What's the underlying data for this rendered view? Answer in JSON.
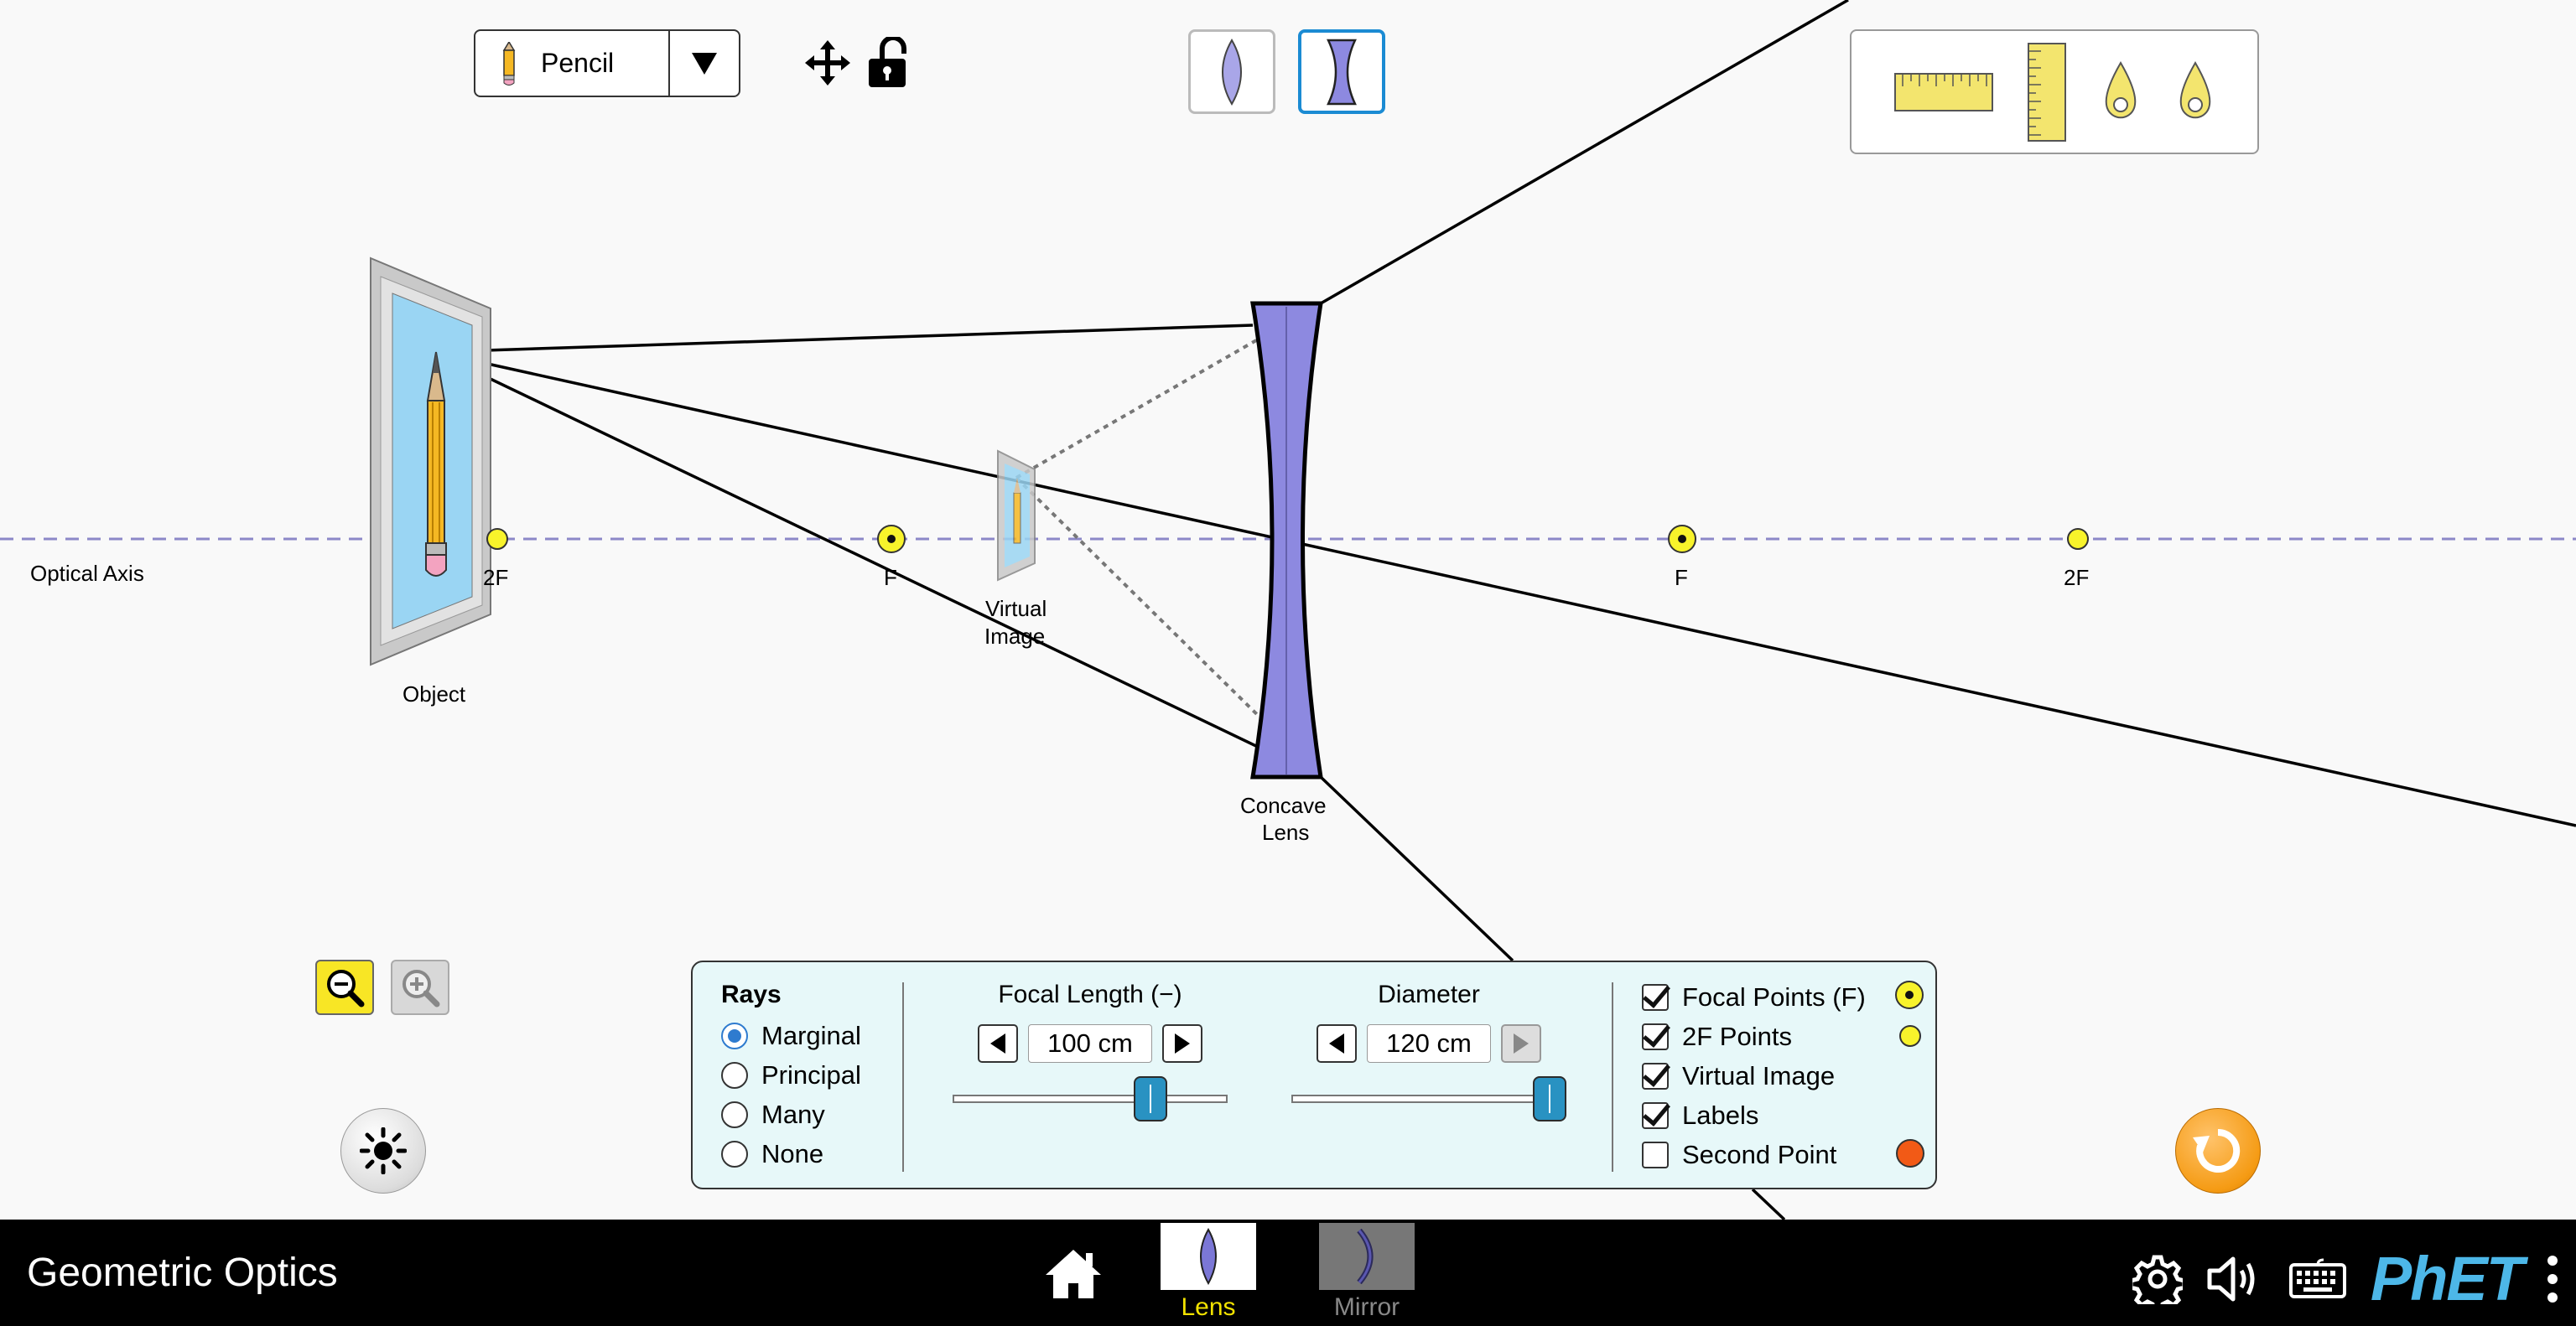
{
  "object_selector": {
    "label": "Pencil"
  },
  "scene": {
    "axis_label": "Optical Axis",
    "object_label": "Object",
    "image_label_line1": "Virtual",
    "image_label_line2": "Image",
    "lens_label_line1": "Concave",
    "lens_label_line2": "Lens",
    "left_2f_label": "2F",
    "left_f_label": "F",
    "right_f_label": "F",
    "right_2f_label": "2F"
  },
  "panel": {
    "rays_title": "Rays",
    "rays": [
      {
        "label": "Marginal",
        "selected": true
      },
      {
        "label": "Principal",
        "selected": false
      },
      {
        "label": "Many",
        "selected": false
      },
      {
        "label": "None",
        "selected": false
      }
    ],
    "focal_length": {
      "title": "Focal Length (−)",
      "value": "100 cm",
      "slider_fraction": 0.75
    },
    "diameter": {
      "title": "Diameter",
      "value": "120 cm",
      "slider_fraction": 1.0
    },
    "checks": [
      {
        "label": "Focal Points (F)",
        "checked": true
      },
      {
        "label": "2F Points",
        "checked": true
      },
      {
        "label": "Virtual Image",
        "checked": true
      },
      {
        "label": "Labels",
        "checked": true
      },
      {
        "label": "Second Point",
        "checked": false
      }
    ]
  },
  "navbar": {
    "title": "Geometric Optics",
    "screens": [
      {
        "label": "Lens",
        "selected": true
      },
      {
        "label": "Mirror",
        "selected": false
      }
    ],
    "brand": "PhET"
  },
  "colors": {
    "lens_fill": "#8d89e0",
    "focal_point": "#f8f32b",
    "selected_screen_caption": "#f2e200",
    "second_point": "#f25a16",
    "accent_blue": "#1b8bd3"
  }
}
